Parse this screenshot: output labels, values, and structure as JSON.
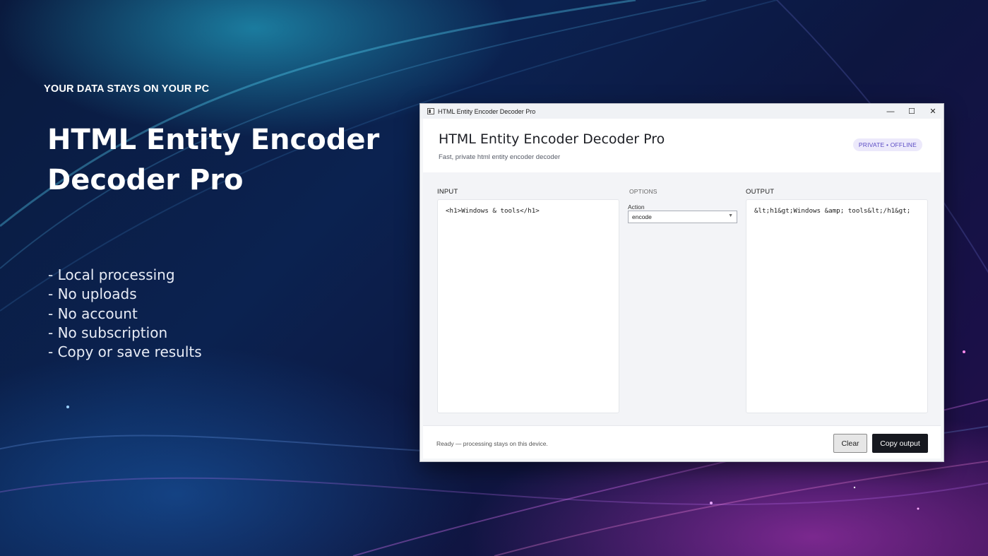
{
  "hero": {
    "eyebrow": "YOUR DATA STAYS ON YOUR PC",
    "title_line1": "HTML Entity Encoder",
    "title_line2": "Decoder Pro",
    "bullets": [
      "- Local processing",
      "- No uploads",
      "- No account",
      "- No subscription",
      "- Copy or save results"
    ]
  },
  "window": {
    "title": "HTML Entity Encoder Decoder Pro",
    "controls": {
      "minimize": "—",
      "maximize": "☐",
      "close": "✕"
    }
  },
  "app": {
    "title": "HTML Entity Encoder Decoder Pro",
    "subtitle": "Fast, private html entity encoder decoder",
    "badge": "PRIVATE • OFFLINE"
  },
  "input": {
    "label": "INPUT",
    "value": "<h1>Windows & tools</h1>"
  },
  "options": {
    "label": "OPTIONS",
    "action_label": "Action",
    "action_value": "encode"
  },
  "output": {
    "label": "OUTPUT",
    "value": "&lt;h1&gt;Windows &amp; tools&lt;/h1&gt;"
  },
  "footer": {
    "status": "Ready — processing stays on this device.",
    "clear_label": "Clear",
    "copy_label": "Copy output"
  }
}
